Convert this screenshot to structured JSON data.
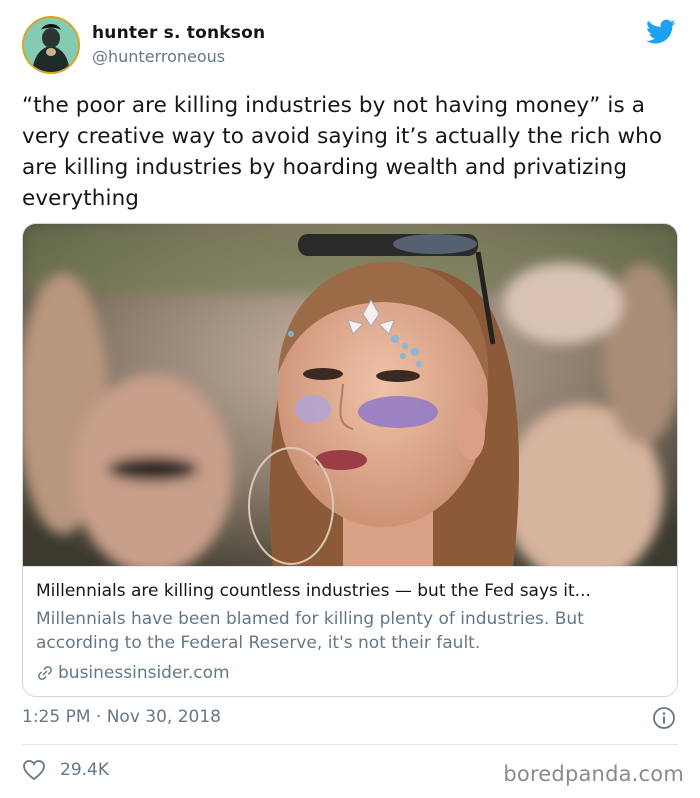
{
  "tweet": {
    "author": {
      "display_name": "hunter s. tonkson",
      "handle": "@hunterroneous"
    },
    "text": "“the poor are killing industries by not having money” is a very creative way to avoid saying it’s actually the rich who are killing industries by hoarding wealth and privatizing everything",
    "timestamp": "1:25 PM · Nov 30, 2018",
    "likes": "29.4K"
  },
  "card": {
    "title": "Millennials are killing countless industries — but the Fed says it...",
    "description": "Millennials have been blamed for killing plenty of industries. But according to the Federal Reserve, it's not their fault.",
    "domain": "businessinsider.com"
  },
  "watermark": "boredpanda.com",
  "icons": {
    "bird": "twitter-bird-icon",
    "link": "link-icon",
    "info": "info-icon",
    "heart": "heart-icon"
  },
  "colors": {
    "brand_blue": "#1da1f2",
    "text_primary": "#14171a",
    "text_secondary": "#657786",
    "border": "#ccd6dd"
  }
}
